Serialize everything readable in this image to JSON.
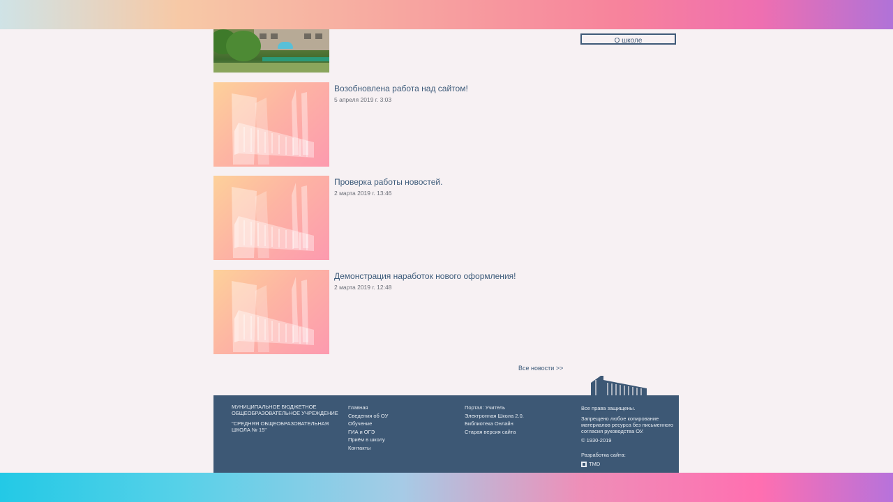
{
  "about_button": "О школе",
  "news": [
    {
      "title": "Возобновлена работа над сайтом!",
      "date": "5 апреля 2019 г. 3:03"
    },
    {
      "title": "Проверка работы новостей.",
      "date": "2 марта 2019 г. 13:46"
    },
    {
      "title": "Демонстрация наработок нового оформления!",
      "date": "2 марта 2019 г. 12:48"
    }
  ],
  "all_news": "Все новости >>",
  "footer": {
    "org_lines": [
      "МУНИЦИПАЛЬНОЕ БЮДЖЕТНОЕ",
      "ОБЩЕОБРАЗОВАТЕЛЬНОЕ УЧРЕЖДЕНИЕ",
      "\"СРЕДНЯЯ ОБЩЕОБРАЗОВАТЕЛЬНАЯ",
      "ШКОЛА № 15\""
    ],
    "nav_links": [
      "Главная",
      "Сведения об ОУ",
      "Обучение",
      "ГИА и ОГЭ",
      "Приём в школу",
      "Контакты"
    ],
    "portal_links": [
      "Портал: Учитель",
      "Электронная Школа 2.0.",
      "Библиотека Онлайн",
      "Старая версия сайта"
    ],
    "rights": "Все права защищены.",
    "copy_note_lines": [
      "Запрещено любое копирование",
      "материалов ресурса без письменного",
      "согласия руководства ОУ."
    ],
    "years": "© 1930-2019",
    "dev_label": "Разработка сайта:",
    "dev_name": "TMD"
  },
  "colors": {
    "accent": "#3d5b7a",
    "footer_bg": "#3d5875",
    "page_bg": "#f7f1f3"
  },
  "icons": [
    "school-building-icon",
    "tmd-logo-icon"
  ]
}
